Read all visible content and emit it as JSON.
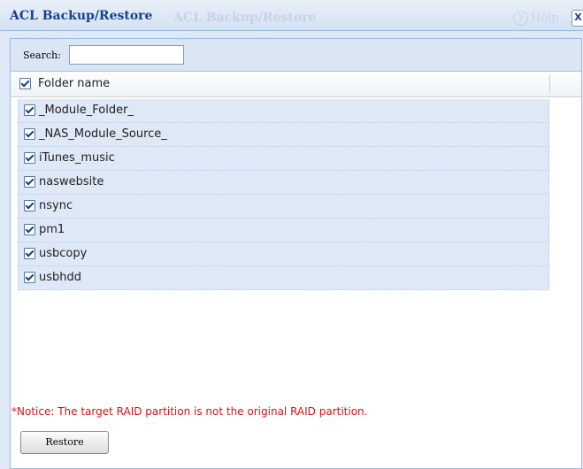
{
  "window": {
    "title": "ACL Backup/Restore",
    "ghost_title": "ACL Backup/Restore",
    "help_label": "Help",
    "close_label": "X"
  },
  "search": {
    "label": "Search:",
    "value": ""
  },
  "grid": {
    "header": {
      "column": "Folder name",
      "checked": true
    },
    "rows": [
      {
        "name": "_Module_Folder_",
        "checked": true
      },
      {
        "name": "_NAS_Module_Source_",
        "checked": true
      },
      {
        "name": "iTunes_music",
        "checked": true
      },
      {
        "name": "naswebsite",
        "checked": true
      },
      {
        "name": "nsync",
        "checked": true
      },
      {
        "name": "pm1",
        "checked": true
      },
      {
        "name": "usbcopy",
        "checked": true
      },
      {
        "name": "usbhdd",
        "checked": true
      }
    ]
  },
  "notice": "*Notice: The target RAID partition is not the original RAID partition.",
  "buttons": {
    "restore": "Restore"
  },
  "colors": {
    "accent": "#15428b",
    "notice": "#e01010",
    "row_bg": "#dfe8f6"
  }
}
